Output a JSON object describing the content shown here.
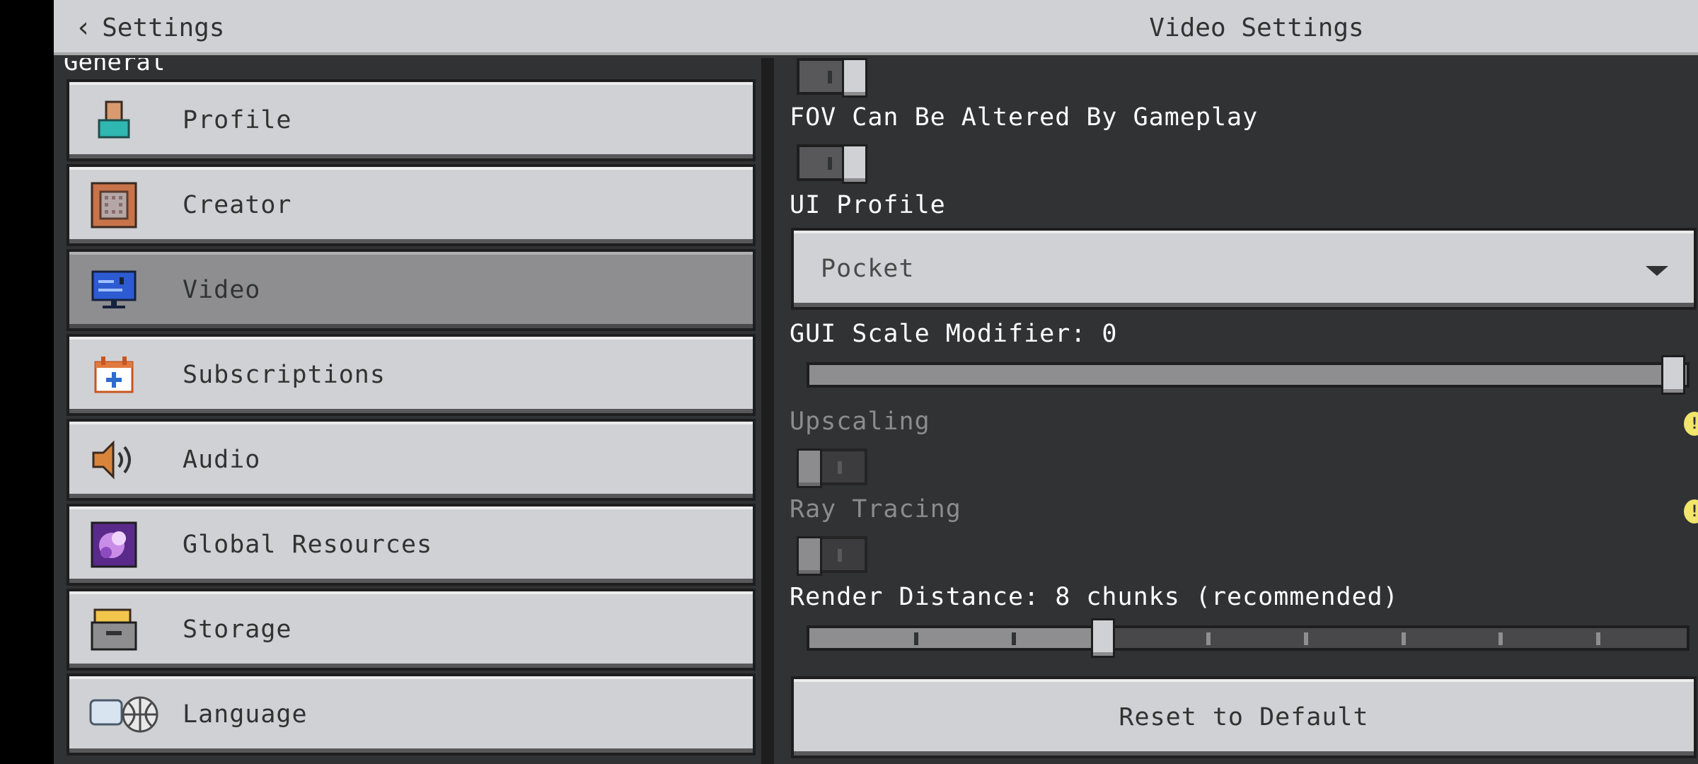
{
  "header": {
    "back_label": "Settings",
    "title": "Video Settings"
  },
  "sidebar": {
    "section_label": "General",
    "items": [
      {
        "label": "Profile",
        "icon": "profile-icon",
        "active": false
      },
      {
        "label": "Creator",
        "icon": "creator-icon",
        "active": false
      },
      {
        "label": "Video",
        "icon": "video-icon",
        "active": true
      },
      {
        "label": "Subscriptions",
        "icon": "subscriptions-icon",
        "active": false
      },
      {
        "label": "Audio",
        "icon": "audio-icon",
        "active": false
      },
      {
        "label": "Global Resources",
        "icon": "global-resources-icon",
        "active": false
      },
      {
        "label": "Storage",
        "icon": "storage-icon",
        "active": false
      },
      {
        "label": "Language",
        "icon": "language-icon",
        "active": false
      }
    ]
  },
  "content": {
    "fov_toggle_state": "on",
    "fov_altered_label": "FOV Can Be Altered By Gameplay",
    "fov_altered_state": "on",
    "ui_profile_label": "UI Profile",
    "ui_profile_value": "Pocket",
    "gui_scale_label": "GUI Scale Modifier: 0",
    "gui_scale_value_fraction": 1.0,
    "upscaling_label": "Upscaling",
    "upscaling_state": "off",
    "ray_tracing_label": "Ray Tracing",
    "ray_tracing_state": "off",
    "render_distance_label": "Render Distance: 8 chunks (recommended)",
    "render_distance_fraction": 0.335,
    "render_distance_ticks": 8,
    "reset_label": "Reset to Default",
    "info_icon": "info-icon"
  },
  "colors": {
    "panel_bg": "#313233",
    "button_bg": "#d0d1d4",
    "active_bg": "#8e8e90",
    "info_yellow": "#f1e56b"
  }
}
